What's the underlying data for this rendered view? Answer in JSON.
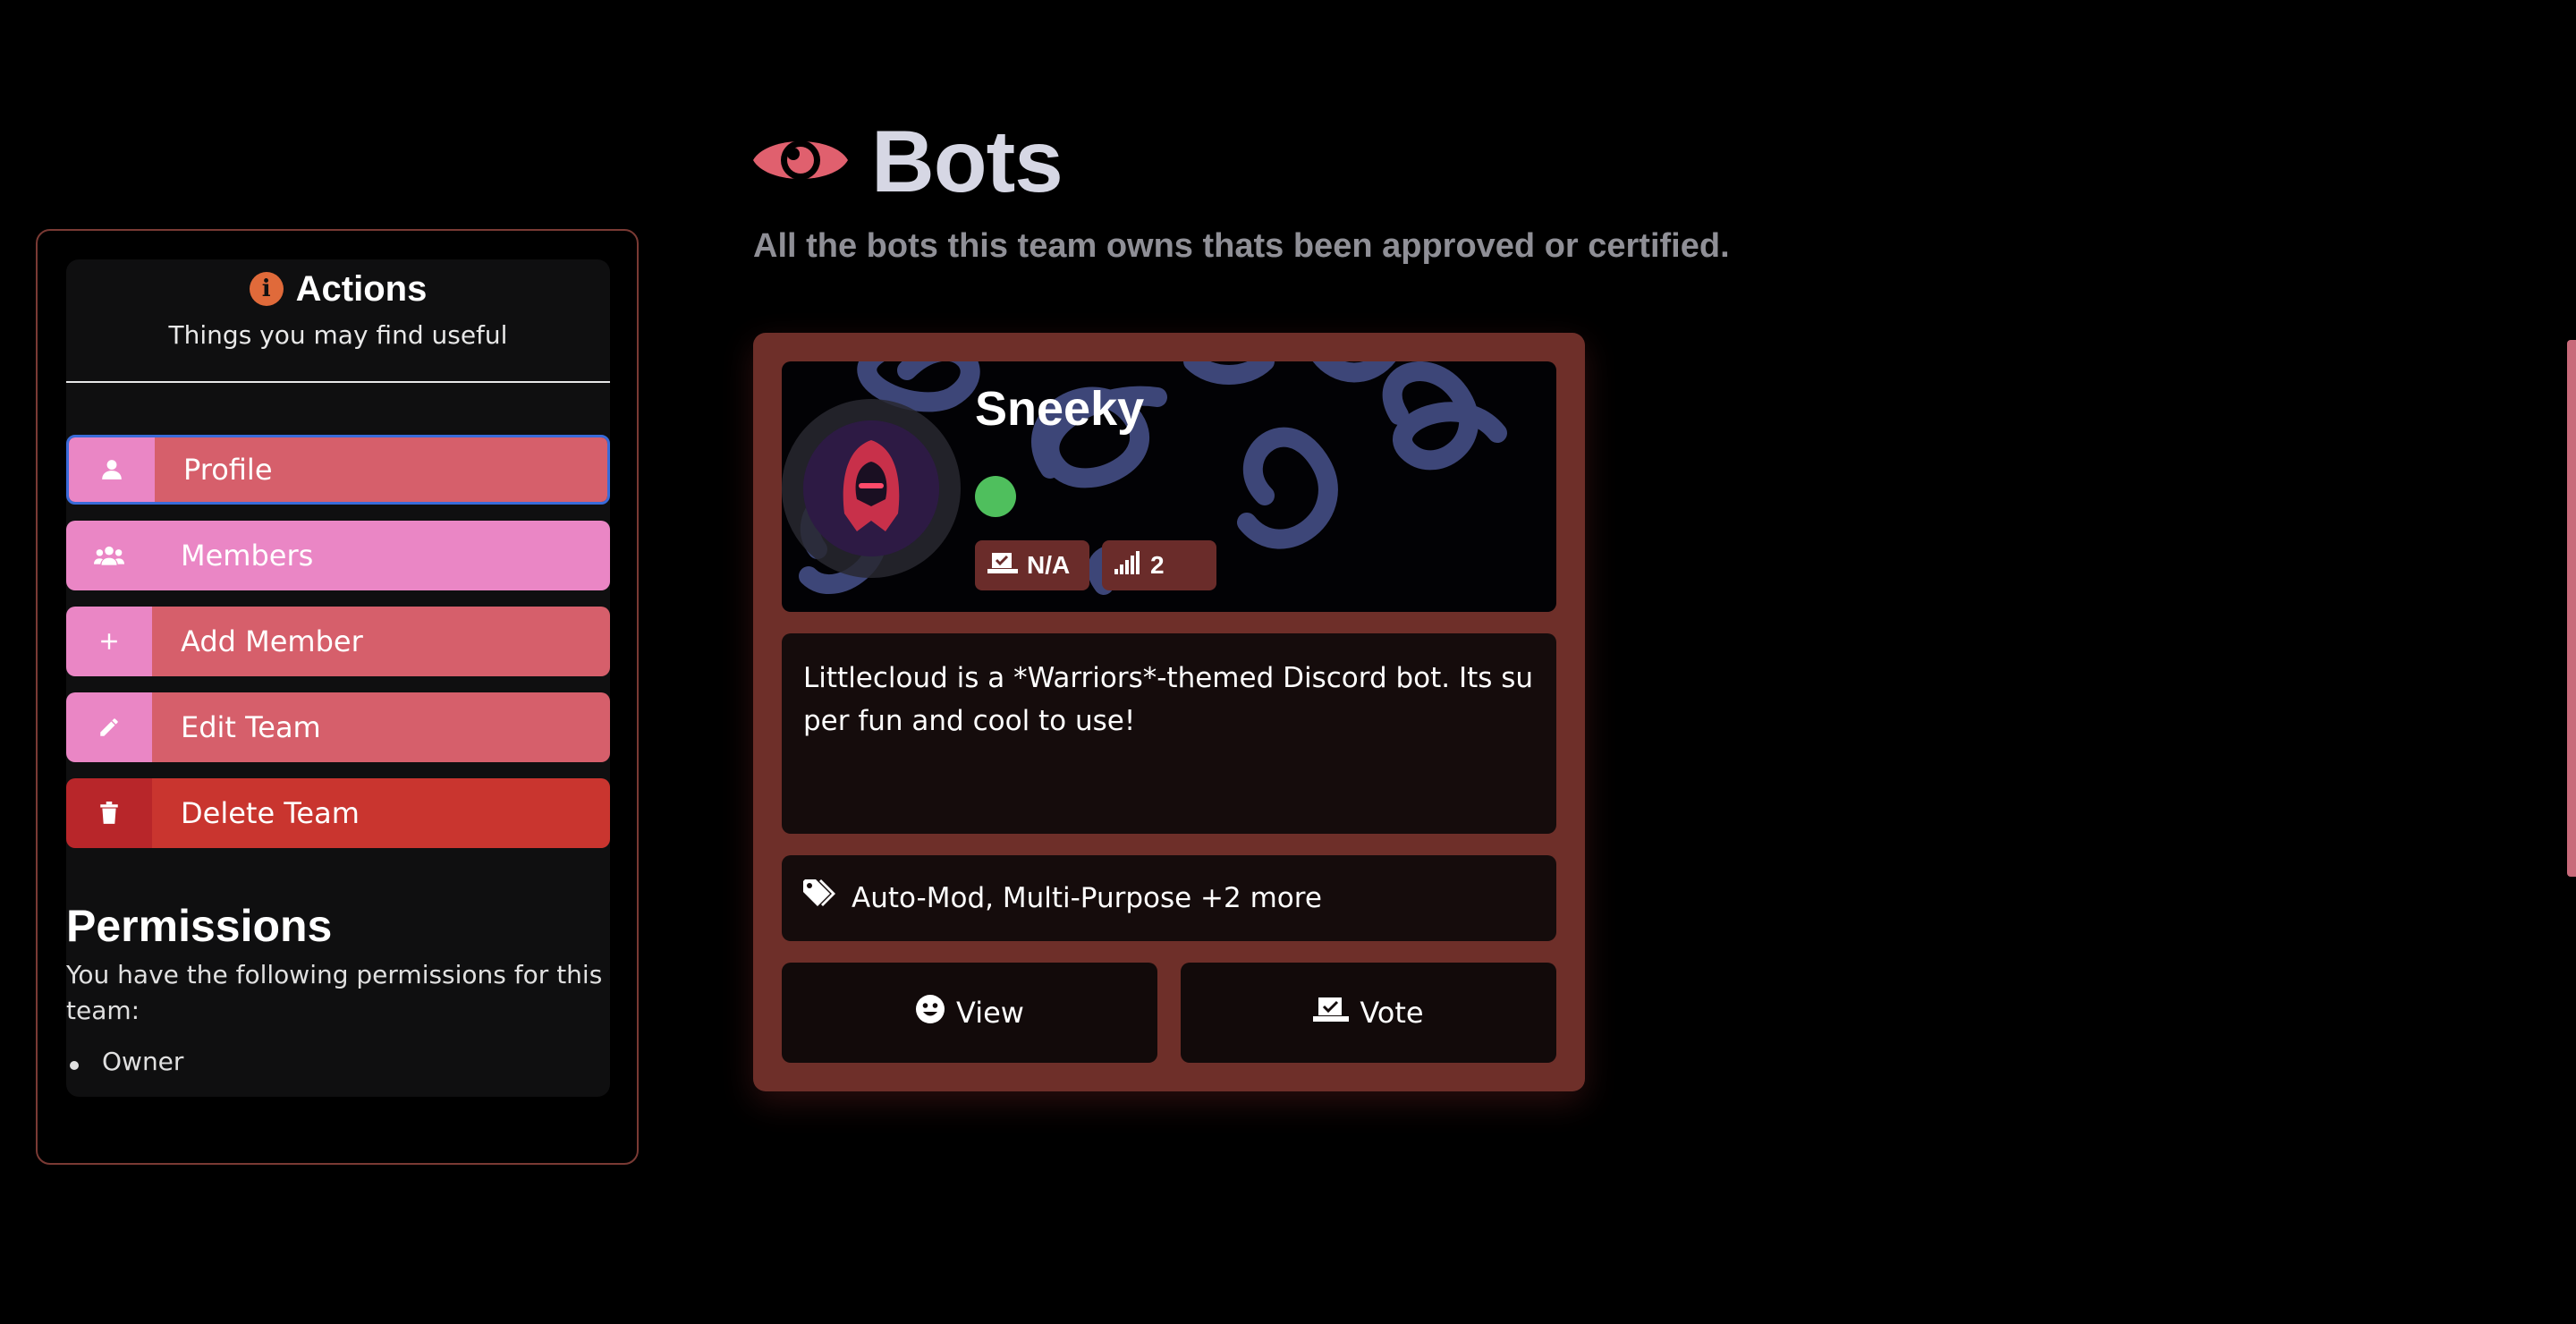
{
  "sidebar": {
    "actions_title": "Actions",
    "actions_subtitle": "Things you may find useful",
    "buttons": {
      "profile": "Profile",
      "members": "Members",
      "add_member": "Add Member",
      "edit_team": "Edit Team",
      "delete_team": "Delete Team"
    },
    "permissions_title": "Permissions",
    "permissions_description": "You have the following permissions for this team:",
    "permissions": [
      "Owner"
    ]
  },
  "main": {
    "title": "Bots",
    "subtitle": "All the bots this team owns thats been approved or certified."
  },
  "bot_card": {
    "name": "Sneeky",
    "status": "online",
    "votes": "N/A",
    "servers": "2",
    "description": "Littlecloud is a *Warriors*-themed Discord bot. Its super fun and cool to use!",
    "tags": "Auto-Mod, Multi-Purpose +2 more",
    "view_label": "View",
    "vote_label": "Vote"
  },
  "colors": {
    "background": "#000000",
    "accent_pink": "#ea86c5",
    "accent_red": "#d65f6b",
    "danger": "#c9352f",
    "card": "#6e2f29",
    "status_online": "#4fbf5d",
    "title_eye": "#e0606e"
  }
}
